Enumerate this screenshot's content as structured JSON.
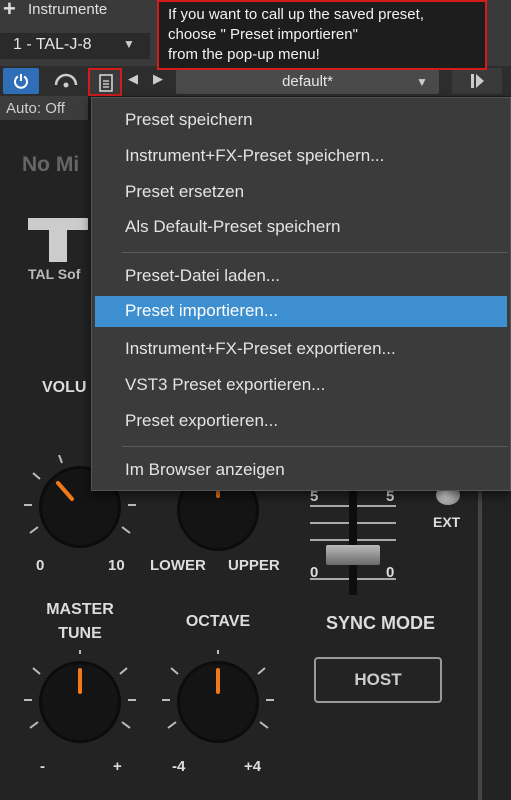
{
  "header": {
    "instruments_label": "Instrumente",
    "instrument_name": "1 - TAL-J-8"
  },
  "tooltip": {
    "lines": [
      "If you want to call up the saved preset,",
      "choose \" Preset importieren\"",
      "from the pop-up menu!"
    ]
  },
  "toolbar": {
    "preset_name": "default*",
    "auto_label": "Auto: Off"
  },
  "menu": {
    "items": [
      "Preset speichern",
      "Instrument+FX-Preset speichern...",
      "Preset ersetzen",
      "Als Default-Preset speichern",
      "Preset-Datei laden...",
      "Preset importieren...",
      "Instrument+FX-Preset exportieren...",
      "VST3 Preset exportieren...",
      "Preset exportieren...",
      "Im Browser anzeigen"
    ],
    "selected_index": 5
  },
  "plugin": {
    "no_midi": "No Mi",
    "brand": "TAL Sof",
    "volume_label": "VOLU",
    "volume_min": "0",
    "volume_max": "10",
    "lower_label": "LOWER",
    "upper_label": "UPPER",
    "slider_top_left": "5",
    "slider_top_right": "5",
    "slider_bottom_left": "0",
    "slider_bottom_right": "0",
    "ext_label": "EXT",
    "master_tune_line1": "MASTER",
    "master_tune_line2": "TUNE",
    "master_min": "-",
    "master_max": "+",
    "octave_label": "OCTAVE",
    "octave_min": "-4",
    "octave_max": "+4",
    "sync_mode_label": "SYNC MODE",
    "host_button": "HOST"
  },
  "colors": {
    "accent_blue": "#3e8fd0",
    "highlight_red": "#d51c1c",
    "knob_indicator": "#f07a1a"
  }
}
